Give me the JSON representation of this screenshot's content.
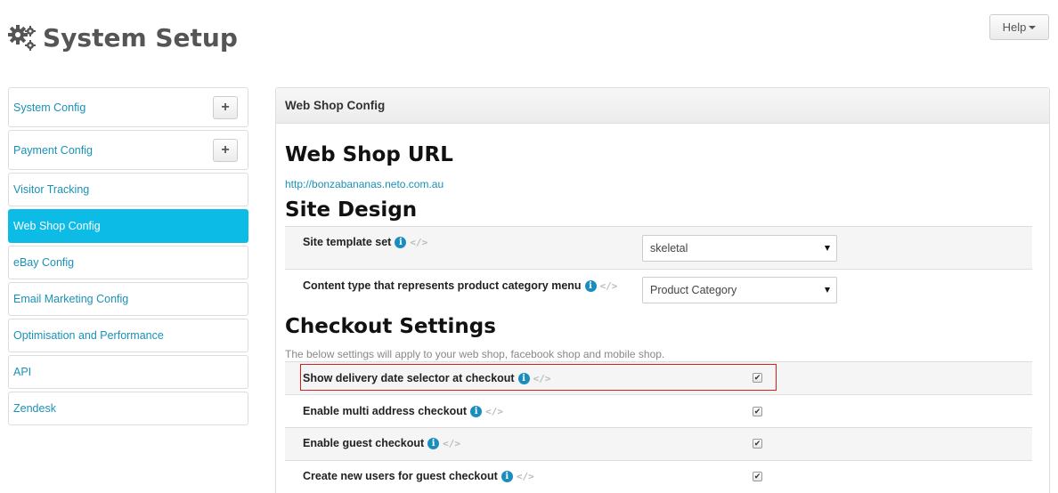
{
  "header": {
    "title": "System Setup",
    "help_label": "Help"
  },
  "sidebar": {
    "items": [
      {
        "label": "System Config",
        "has_plus": true
      },
      {
        "label": "Payment Config",
        "has_plus": true
      },
      {
        "label": "Visitor Tracking"
      },
      {
        "label": "Web Shop Config",
        "active": true
      },
      {
        "label": "eBay Config"
      },
      {
        "label": "Email Marketing Config"
      },
      {
        "label": "Optimisation and Performance"
      },
      {
        "label": "API"
      },
      {
        "label": "Zendesk"
      }
    ]
  },
  "panel": {
    "heading": "Web Shop Config",
    "web_shop_url": {
      "title": "Web Shop URL",
      "url": "http://bonzabananas.neto.com.au"
    },
    "site_design": {
      "title": "Site Design",
      "rows": [
        {
          "label": "Site template set",
          "value": "skeletal"
        },
        {
          "label": "Content type that represents product category menu",
          "value": "Product Category"
        }
      ]
    },
    "checkout": {
      "title": "Checkout Settings",
      "description": "The below settings will apply to your web shop, facebook shop and mobile shop.",
      "rows": [
        {
          "label": "Show delivery date selector at checkout",
          "checked": true
        },
        {
          "label": "Enable multi address checkout",
          "checked": true
        },
        {
          "label": "Enable guest checkout",
          "checked": true
        },
        {
          "label": "Create new users for guest checkout",
          "checked": true
        }
      ]
    }
  },
  "icons": {
    "info": "i",
    "code": "</>",
    "check": "✔",
    "plus": "+"
  },
  "colors": {
    "accent": "#0cbbe6",
    "link": "#1a91b8",
    "highlight": "#d42020",
    "info": "#1a8cbe"
  }
}
